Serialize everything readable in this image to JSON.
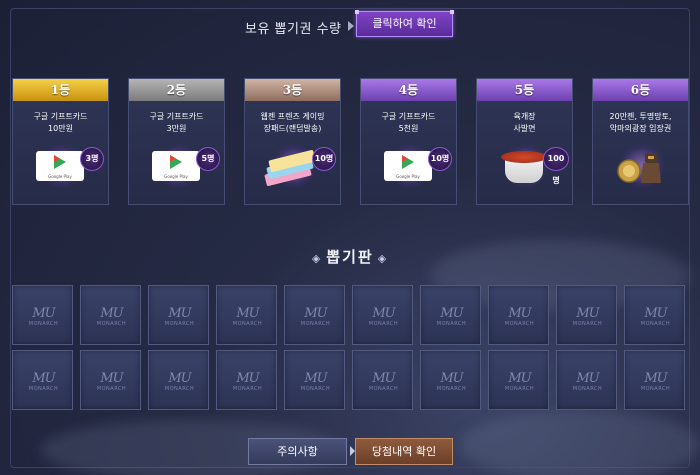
{
  "header": {
    "ticket_label": "보유 뽑기권 수량",
    "check_button": "클릭하여 확인"
  },
  "prizes": [
    {
      "rank": "1등",
      "name": "구글 기프트카드\n10만원",
      "count": "3명",
      "color": "#e9b41e",
      "image": "google-play-card"
    },
    {
      "rank": "2등",
      "name": "구글 기프트카드\n3만원",
      "count": "5명",
      "color": "#9a9a9a",
      "image": "google-play-card"
    },
    {
      "rank": "3등",
      "name": "웹젠 프렌즈 게이밍\n장패드(랜덤발송)",
      "count": "10명",
      "color": "#b89a8a",
      "image": "gaming-pads"
    },
    {
      "rank": "4등",
      "name": "구글 기프트카드\n5천원",
      "count": "10명",
      "color": "#8a5ad0",
      "image": "google-play-card"
    },
    {
      "rank": "5등",
      "name": "육개장\n사발면",
      "count": "100명",
      "color": "#8a5ad0",
      "image": "cup-noodle"
    },
    {
      "rank": "6등",
      "name": "20만젠, 투명망토,\n악마의광장 입장권",
      "count": "",
      "color": "#8a5ad0",
      "image": "game-items"
    }
  ],
  "board": {
    "title": "뽑기판",
    "tile_logo": "MU",
    "tile_sub": "MONARCH",
    "tile_count": 20
  },
  "buttons": {
    "notice": "주의사항",
    "history": "당첨내역 확인"
  },
  "google_play_text": "Google Play"
}
